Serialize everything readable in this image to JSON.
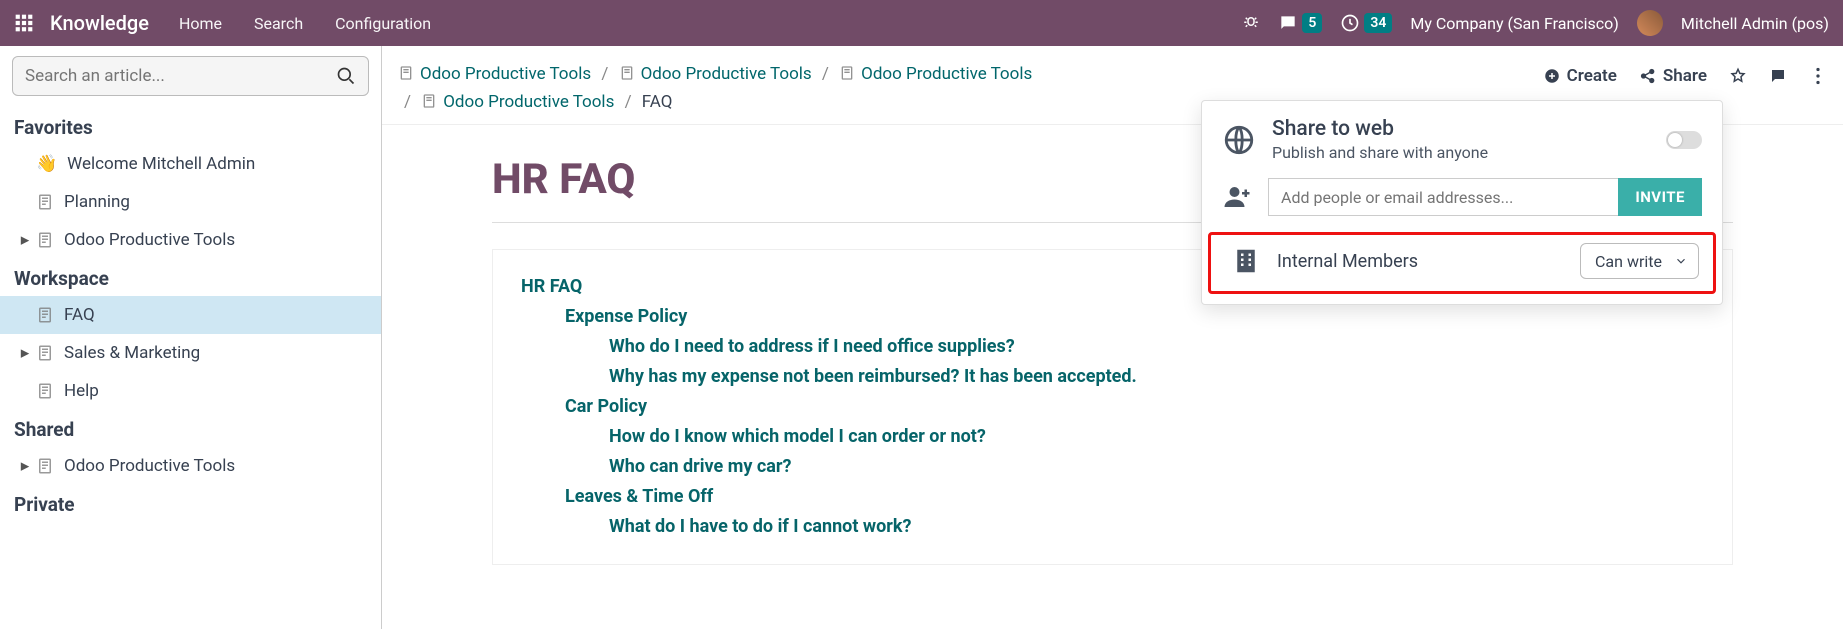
{
  "topbar": {
    "brand": "Knowledge",
    "nav": {
      "home": "Home",
      "search": "Search",
      "config": "Configuration"
    },
    "msg_count": "5",
    "clock_count": "34",
    "company": "My Company (San Francisco)",
    "user": "Mitchell Admin (pos)"
  },
  "sidebar": {
    "search_placeholder": "Search an article...",
    "favorites_title": "Favorites",
    "fav": {
      "welcome": "Welcome Mitchell Admin",
      "planning": "Planning",
      "tools": "Odoo Productive Tools"
    },
    "workspace_title": "Workspace",
    "ws": {
      "faq": "FAQ",
      "sales": "Sales & Marketing",
      "help": "Help"
    },
    "shared_title": "Shared",
    "shared": {
      "tools": "Odoo Productive Tools"
    },
    "private_title": "Private"
  },
  "breadcrumbs": {
    "b1": "Odoo Productive Tools",
    "b2": "Odoo Productive Tools",
    "b3": "Odoo Productive Tools",
    "b4": "Odoo Productive Tools",
    "b5": "FAQ"
  },
  "actions": {
    "create": "Create",
    "share": "Share"
  },
  "page": {
    "title": "HR FAQ"
  },
  "toc": {
    "root": "HR FAQ",
    "s1": "Expense Policy",
    "s1q1": "Who do I need to address if I need office supplies?",
    "s1q2": "Why has my expense not been reimbursed? It has been accepted.",
    "s2": "Car Policy",
    "s2q1": "How do I know which model I can order or not?",
    "s2q2": "Who can drive my car?",
    "s3": "Leaves & Time Off",
    "s3q1": "What do I have to do if I cannot work?"
  },
  "share_pop": {
    "title": "Share to web",
    "sub": "Publish and share with anyone",
    "placeholder": "Add people or email addresses...",
    "invite": "INVITE",
    "internal": "Internal Members",
    "permission": "Can write"
  }
}
